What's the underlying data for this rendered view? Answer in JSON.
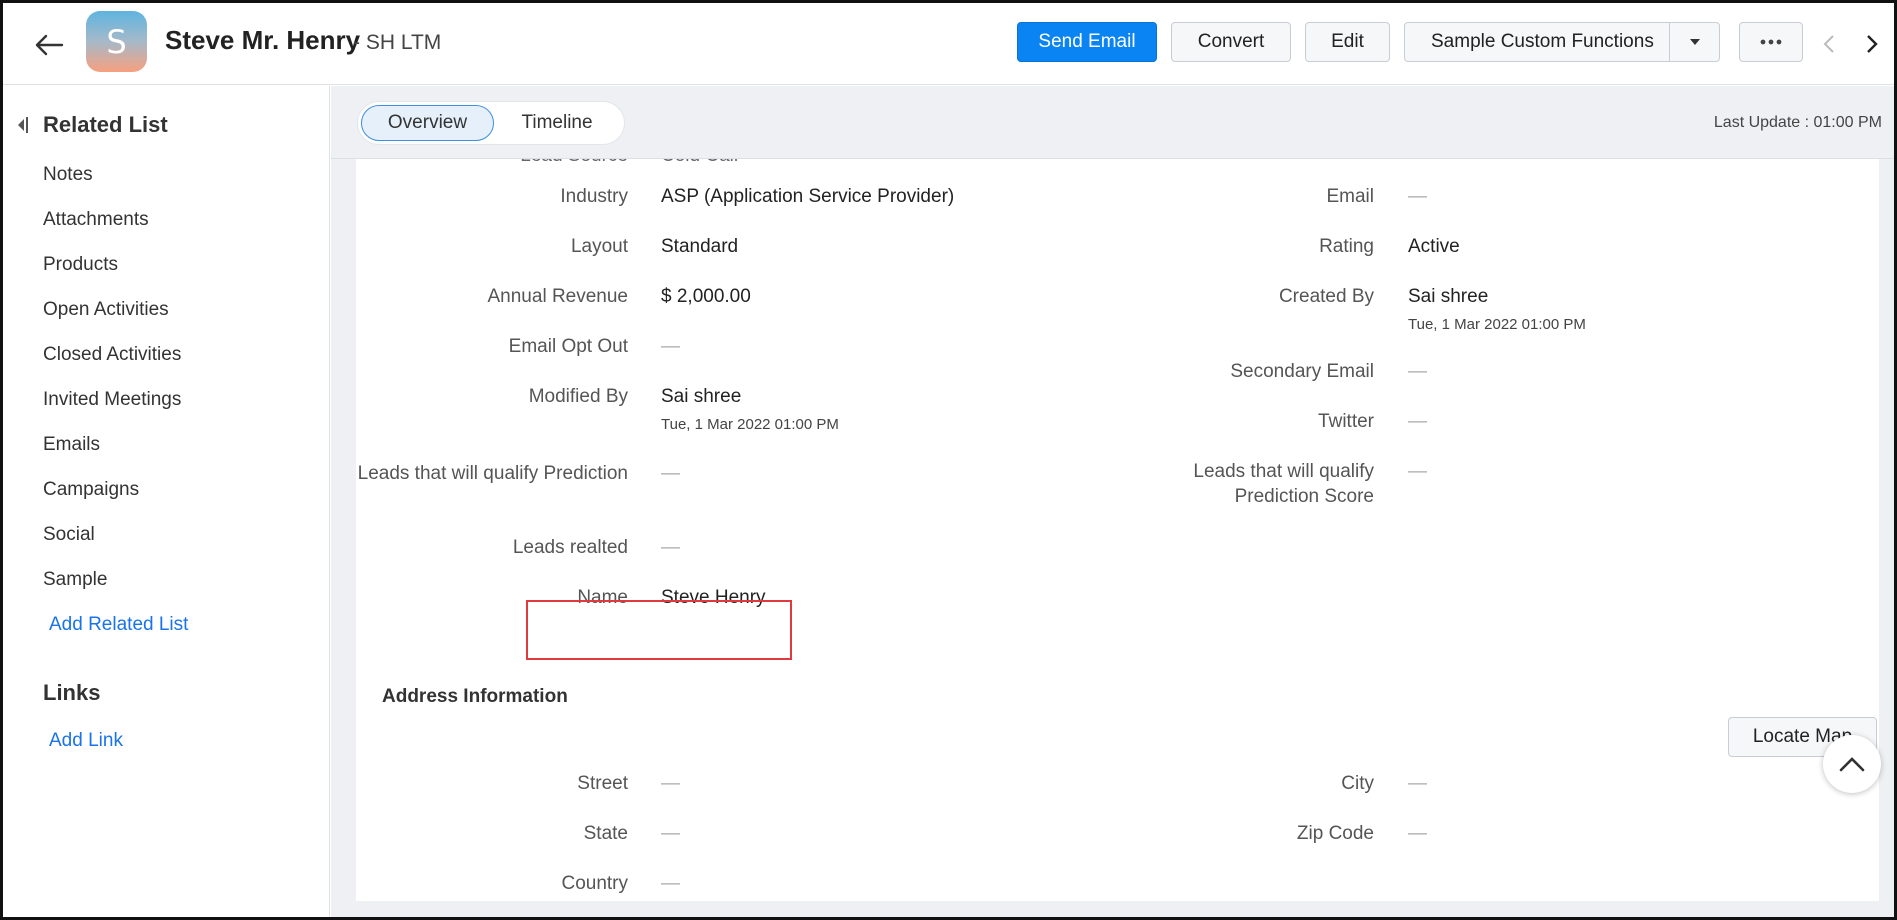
{
  "header": {
    "avatar_letter": "S",
    "record_name": "Steve Mr. Henry",
    "record_sub": "- SH LTM",
    "buttons": {
      "send_email": "Send Email",
      "convert": "Convert",
      "edit": "Edit",
      "custom_functions": "Sample Custom Functions"
    },
    "icons": [
      "arrow-left-icon",
      "caret-down-icon",
      "more-icon",
      "chevron-left-icon",
      "chevron-right-icon"
    ]
  },
  "sidebar": {
    "title": "Related List",
    "items": [
      "Notes",
      "Attachments",
      "Products",
      "Open Activities",
      "Closed Activities",
      "Invited Meetings",
      "Emails",
      "Campaigns",
      "Social",
      "Sample"
    ],
    "add_related_list": "Add Related List",
    "links_title": "Links",
    "add_link": "Add Link"
  },
  "tabs": {
    "overview": "Overview",
    "timeline": "Timeline",
    "last_update": "Last Update : 01:00 PM"
  },
  "details": {
    "partial_top_left": "Lead Source",
    "partial_top_left_value": "Cold Call",
    "left": [
      {
        "label": "Industry",
        "value": "ASP (Application Service Provider)"
      },
      {
        "label": "Layout",
        "value": "Standard"
      },
      {
        "label": "Annual Revenue",
        "value": "$ 2,000.00"
      },
      {
        "label": "Email Opt Out",
        "value": "—"
      },
      {
        "label": "Modified By",
        "value": "Sai shree",
        "sub": "Tue, 1 Mar 2022 01:00 PM"
      },
      {
        "label": "Leads that will qualify Prediction",
        "value": "—"
      },
      {
        "label": "Leads realted",
        "value": "—"
      },
      {
        "label": "Name",
        "value": "Steve Henry"
      }
    ],
    "right": [
      {
        "label": "Email",
        "value": "—"
      },
      {
        "label": "Rating",
        "value": "Active"
      },
      {
        "label": "Created By",
        "value": "Sai shree",
        "sub": "Tue, 1 Mar 2022 01:00 PM"
      },
      {
        "label": "Secondary Email",
        "value": "—"
      },
      {
        "label": "Twitter",
        "value": "—"
      },
      {
        "label": "Leads that will qualify Prediction Score",
        "value": "—"
      }
    ]
  },
  "address": {
    "title": "Address Information",
    "locate_map": "Locate Map",
    "fields": [
      {
        "label": "Street",
        "value": "—"
      },
      {
        "label": "City",
        "value": "—"
      },
      {
        "label": "State",
        "value": "—"
      },
      {
        "label": "Zip Code",
        "value": "—"
      },
      {
        "label": "Country",
        "value": "—"
      }
    ]
  }
}
